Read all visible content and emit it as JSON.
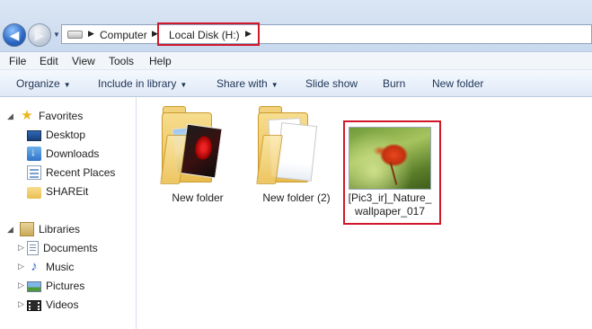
{
  "address_bar": {
    "crumbs": [
      "Computer",
      "Local Disk (H:)"
    ],
    "back_icon": "back-arrow-icon",
    "forward_icon": "forward-arrow-icon"
  },
  "menu": {
    "items": [
      "File",
      "Edit",
      "View",
      "Tools",
      "Help"
    ]
  },
  "command_bar": {
    "items": [
      {
        "label": "Organize",
        "dropdown": true
      },
      {
        "label": "Include in library",
        "dropdown": true
      },
      {
        "label": "Share with",
        "dropdown": true
      },
      {
        "label": "Slide show",
        "dropdown": false
      },
      {
        "label": "Burn",
        "dropdown": false
      },
      {
        "label": "New folder",
        "dropdown": false
      }
    ]
  },
  "nav_pane": {
    "favorites": {
      "label": "Favorites",
      "items": [
        "Desktop",
        "Downloads",
        "Recent Places",
        "SHAREit"
      ]
    },
    "libraries": {
      "label": "Libraries",
      "items": [
        "Documents",
        "Music",
        "Pictures",
        "Videos"
      ]
    }
  },
  "files": [
    {
      "name": "New folder",
      "type": "folder"
    },
    {
      "name": "New folder (2)",
      "type": "folder"
    },
    {
      "name_line1": "[Pic3_ir]_Nature_",
      "name_line2": "wallpaper_017",
      "type": "image"
    }
  ],
  "colors": {
    "highlight": "#d0182a",
    "address_bg": "#dbe6f4",
    "command_text": "#1e3457"
  }
}
